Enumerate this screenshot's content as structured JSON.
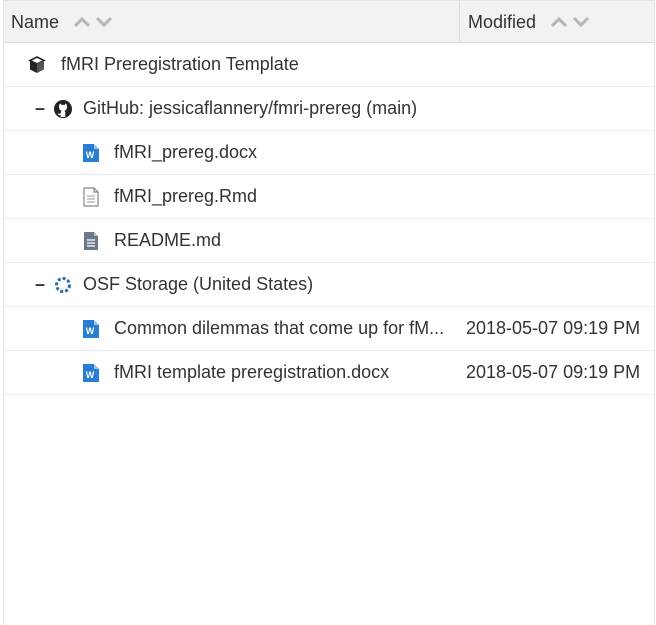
{
  "header": {
    "name_label": "Name",
    "modified_label": "Modified"
  },
  "rows": [
    {
      "label": "fMRI Preregistration Template",
      "modified": "",
      "icon": "project-cube-icon"
    },
    {
      "label": "GitHub: jessicaflannery/fmri-prereg (main)",
      "modified": "",
      "icon": "github-icon",
      "toggle": "–"
    },
    {
      "label": "fMRI_prereg.docx",
      "modified": "",
      "icon": "word-file-icon"
    },
    {
      "label": "fMRI_prereg.Rmd",
      "modified": "",
      "icon": "text-file-icon"
    },
    {
      "label": "README.md",
      "modified": "",
      "icon": "markdown-file-icon"
    },
    {
      "label": "OSF Storage (United States)",
      "modified": "",
      "icon": "osf-storage-icon",
      "toggle": "–"
    },
    {
      "label": "Common dilemmas that come up for fM...",
      "modified": "2018-05-07 09:19 PM",
      "icon": "word-file-icon"
    },
    {
      "label": "fMRI template preregistration.docx",
      "modified": "2018-05-07 09:19 PM",
      "icon": "word-file-icon"
    }
  ],
  "colors": {
    "word_blue": "#2b7cd3",
    "header_bg": "#f2f2f2",
    "sort_arrow": "#b5b5b5"
  }
}
